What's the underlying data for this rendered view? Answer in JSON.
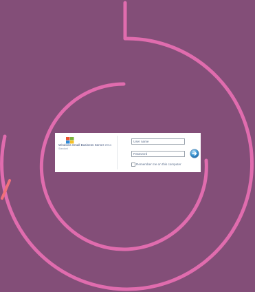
{
  "theme": {
    "background": "#834e78",
    "ring_color": "#e06cae",
    "accent_stroke": "#f0707a"
  },
  "login": {
    "product_name": "Windows Small Business Server",
    "product_version": "2011",
    "product_edition": "Standard",
    "username_placeholder": "User name",
    "password_placeholder": "Password",
    "remember_label": "Remember me on this computer",
    "submit_icon": "arrow-right-icon"
  }
}
